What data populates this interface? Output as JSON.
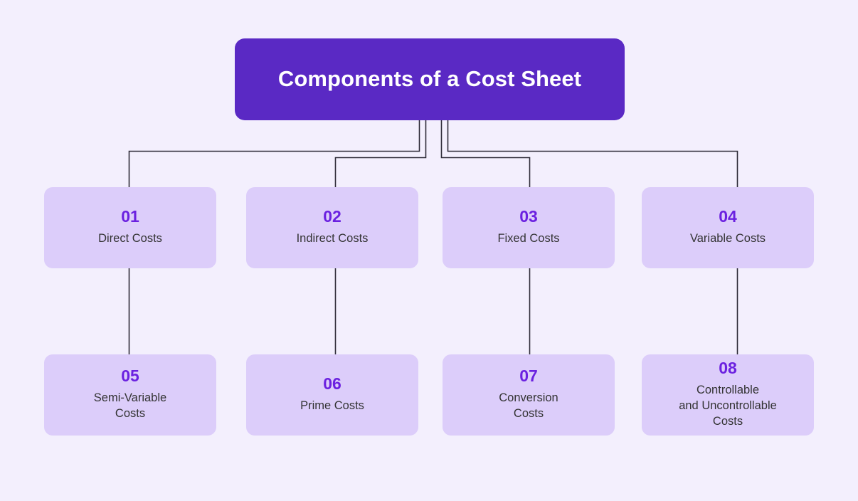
{
  "diagram": {
    "title": "Components of a Cost Sheet",
    "type": "hierarchy-tree",
    "colors": {
      "background": "#f3effd",
      "title_fill": "#5a29c4",
      "title_text": "#ffffff",
      "node_fill": "#dccdfa",
      "node_number": "#6b21e0",
      "node_label": "#333333",
      "connector": "#2e2b38"
    },
    "nodes": [
      {
        "number": "01",
        "label": "Direct Costs"
      },
      {
        "number": "02",
        "label": "Indirect Costs"
      },
      {
        "number": "03",
        "label": "Fixed Costs"
      },
      {
        "number": "04",
        "label": "Variable Costs"
      },
      {
        "number": "05",
        "label": "Semi-Variable\nCosts"
      },
      {
        "number": "06",
        "label": "Prime Costs"
      },
      {
        "number": "07",
        "label": "Conversion\nCosts"
      },
      {
        "number": "08",
        "label": "Controllable\nand Uncontrollable\nCosts"
      }
    ]
  }
}
